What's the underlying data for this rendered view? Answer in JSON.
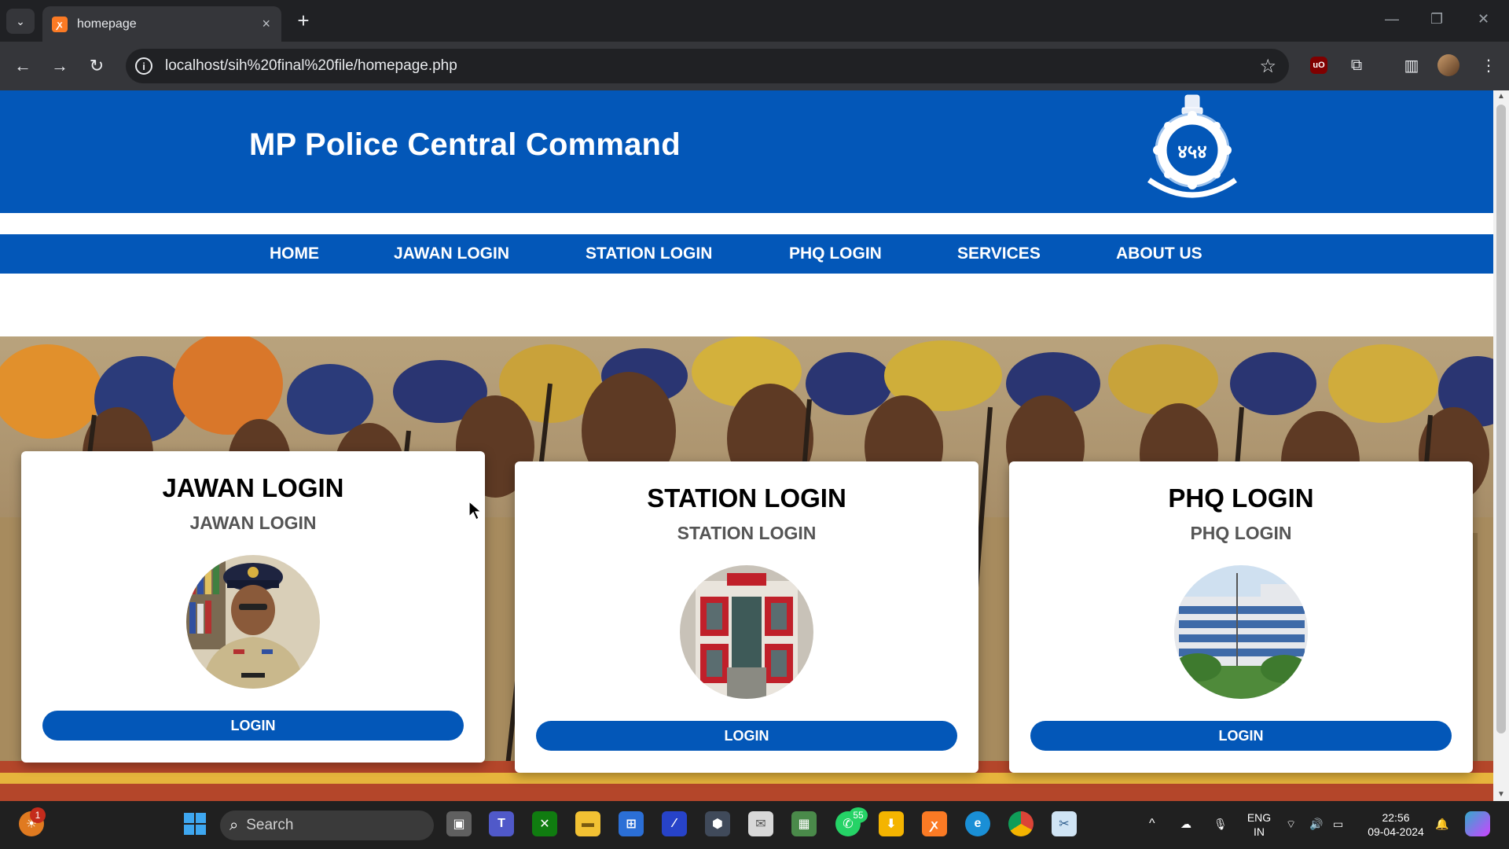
{
  "browser": {
    "tab_title": "homepage",
    "url": "localhost/sih%20final%20file/homepage.php",
    "new_tab_label": "+",
    "close_tab_label": "×"
  },
  "site": {
    "title": "MP Police Central Command",
    "nav": [
      {
        "label": "HOME"
      },
      {
        "label": "JAWAN LOGIN"
      },
      {
        "label": "STATION LOGIN"
      },
      {
        "label": "PHQ LOGIN"
      },
      {
        "label": "SERVICES"
      },
      {
        "label": "ABOUT US"
      }
    ]
  },
  "cards": [
    {
      "title": "JAWAN LOGIN",
      "subtitle": "JAWAN LOGIN",
      "button": "LOGIN",
      "photo": "officer-portrait"
    },
    {
      "title": "STATION LOGIN",
      "subtitle": "STATION LOGIN",
      "button": "LOGIN",
      "photo": "police-station-building"
    },
    {
      "title": "PHQ LOGIN",
      "subtitle": "PHQ LOGIN",
      "button": "LOGIN",
      "photo": "phq-headquarters-building"
    }
  ],
  "taskbar": {
    "search_label": "Search",
    "whatsapp_badge": "55",
    "notification_badge": "1",
    "lang_line1": "ENG",
    "lang_line2": "IN",
    "time": "22:56",
    "date": "09-04-2024"
  },
  "colors": {
    "brand_blue": "#0357b8",
    "chrome_dark": "#202124",
    "chrome_toolbar": "#35363a"
  }
}
